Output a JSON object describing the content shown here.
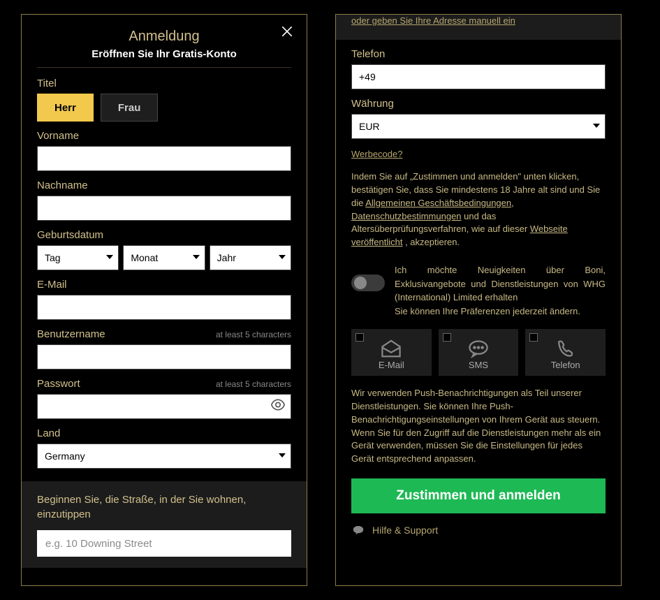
{
  "title": "Anmeldung",
  "subtitle": "Eröffnen Sie Ihr Gratis-Konto",
  "labels": {
    "titel": "Titel",
    "herr": "Herr",
    "frau": "Frau",
    "vorname": "Vorname",
    "nachname": "Nachname",
    "geburtsdatum": "Geburtsdatum",
    "tag": "Tag",
    "monat": "Monat",
    "jahr": "Jahr",
    "email": "E-Mail",
    "benutzername": "Benutzername",
    "passwort": "Passwort",
    "hint_chars": "at least 5 characters",
    "land": "Land",
    "land_value": "Germany",
    "addr_prompt": "Beginnen Sie, die Straße, in der Sie wohnen, einzutippen",
    "addr_placeholder": "e.g. 10 Downing Street",
    "manual_link": "oder geben Sie Ihre Adresse manuell ein",
    "telefon": "Telefon",
    "telefon_value": "+49",
    "waehrung": "Währung",
    "waehrung_value": "EUR",
    "werbecode": "Werbecode?"
  },
  "legal": {
    "pre": "Indem Sie auf „Zustimmen und anmelden\" unten klicken, bestätigen Sie, dass Sie mindestens 18 Jahre alt sind und Sie die ",
    "agb": "Allgemeinen Geschäftsbedingungen",
    "sep1": ", ",
    "datenschutz": "Datenschutzbestimmungen",
    "mid": " und das Altersüberprüfungsverfahren, wie auf dieser ",
    "webseite": "Webseite veröffentlicht",
    "post": " , akzeptieren."
  },
  "marketing": {
    "line1": "Ich möchte Neuigkeiten über Boni, Exklusivangebote und Dienstleistungen von WHG (International) Limited erhalten",
    "line2": "Sie können Ihre Präferenzen jederzeit ändern."
  },
  "prefs": {
    "email": "E-Mail",
    "sms": "SMS",
    "telefon": "Telefon"
  },
  "push_text": "Wir verwenden Push-Benachrichtigungen als Teil unserer Dienstleistungen. Sie können Ihre Push-Benachrichtigungseinstellungen von Ihrem Gerät aus steuern. Wenn Sie für den Zugriff auf die Dienstleistungen mehr als ein Gerät verwenden, müssen Sie die Einstellungen für jedes Gerät entsprechend anpassen.",
  "submit": "Zustimmen und anmelden",
  "help": "Hilfe & Support"
}
